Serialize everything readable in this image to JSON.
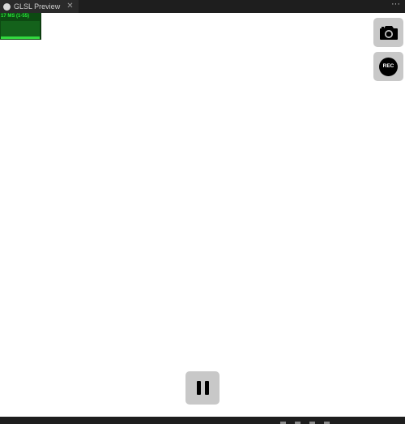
{
  "tab": {
    "title": "GLSL Preview",
    "close_glyph": "✕"
  },
  "toolbar": {
    "more_glyph": "···"
  },
  "stats": {
    "text": "17 MS (1-55)",
    "graph_fill_fraction": 0.12,
    "colors": {
      "background": "#0d4a12",
      "text": "#29e33a"
    }
  },
  "controls": {
    "camera_icon": "camera-icon",
    "rec_label": "REC",
    "pause_icon": "pause-icon"
  },
  "colors": {
    "button_bg": "#c8c8c8",
    "canvas_bg": "#ffffff",
    "chrome_bg": "#1e1e1e"
  }
}
